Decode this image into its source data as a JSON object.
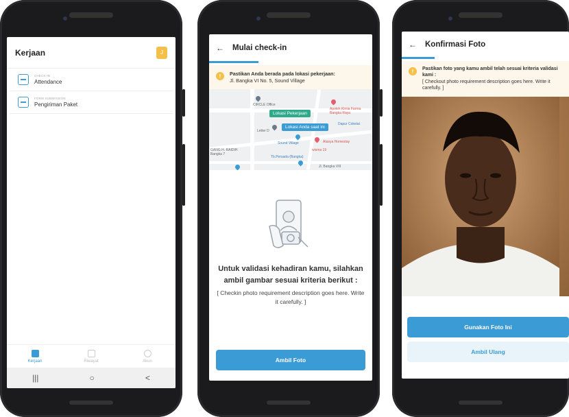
{
  "screen1": {
    "title": "Kerjaan",
    "badge": "J",
    "tasks": [
      {
        "category": "CHECK-IN",
        "name": "Attendance"
      },
      {
        "category": "FORM SUBMISSION",
        "name": "Pengiriman Paket"
      }
    ],
    "nav": [
      {
        "label": "Kerjaan",
        "icon": "briefcase-icon"
      },
      {
        "label": "Riwayat",
        "icon": "history-icon"
      },
      {
        "label": "Akun",
        "icon": "account-icon"
      }
    ],
    "sys": [
      "|||",
      "○",
      "<"
    ]
  },
  "screen2": {
    "back": "←",
    "title": "Mulai check-in",
    "notice_bold": "Pastikan Anda berada pada lokasi pekerjaan:",
    "notice_text": "Jl. Bangka VI No. 5, Sound Village",
    "map": {
      "tag_work": "Lokasi Pekerjaan",
      "tag_you": "Lokasi Anda saat ini",
      "labels": [
        "CIRCLE Office",
        "Apotek Kimia Farma Bangka Raya",
        "Letter D",
        "Dapur Cokelat",
        "Sound Village",
        "Atasya Homestay",
        "wisma 19",
        "GANG H. RAIDIH Bangka 7",
        "Tb.Persada (Bangka)",
        "Jl. Bangka VIII"
      ]
    },
    "headline": "Untuk validasi kehadiran kamu, silahkan ambil gambar sesuai kriteria berikut :",
    "desc": "[ Checkin photo requirement description goes here. Write it carefully. ]",
    "button": "Ambil Foto"
  },
  "screen3": {
    "back": "←",
    "title": "Konfirmasi Foto",
    "notice_bold": "Pastikan foto yang kamu ambil telah sesuai kriteria validasi kami :",
    "notice_text": "[ Checkout photo requirement description goes here. Write it carefully. ]",
    "use_button": "Gunakan Foto Ini",
    "retake_button": "Ambil Ulang"
  }
}
